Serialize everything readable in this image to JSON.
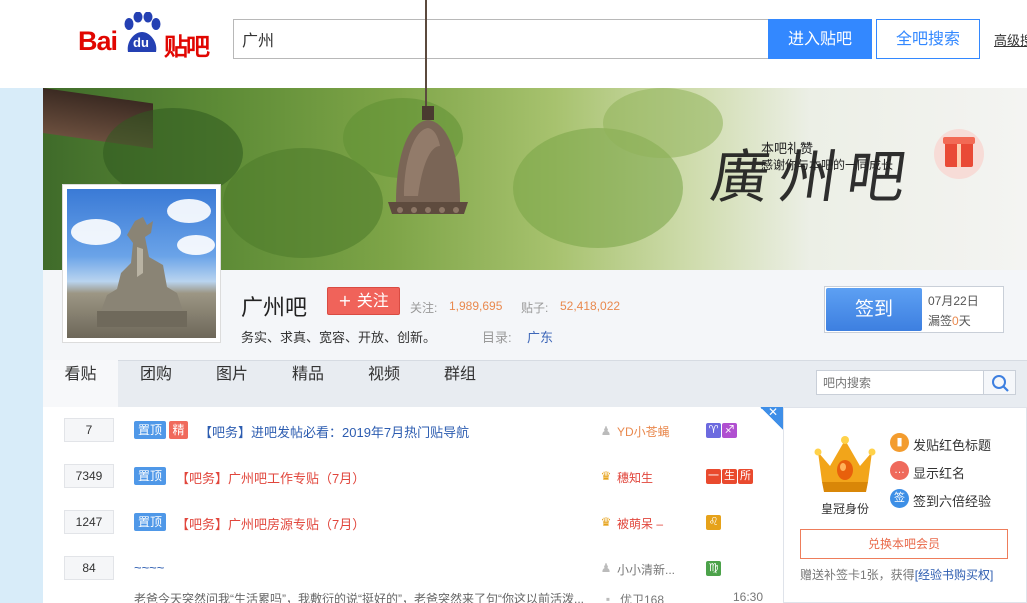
{
  "header": {
    "logo": {
      "bai": "Bai",
      "du": "du",
      "tieba": "贴吧"
    },
    "search_value": "广州",
    "enter_button": "进入贴吧",
    "all_search_button": "全吧搜索",
    "advanced_link": "高级搜"
  },
  "banner": {
    "gift_label": "本吧礼赞",
    "gift_subtitle": "感谢你与本吧的一同成长",
    "calligraphy": "廣州吧"
  },
  "forum": {
    "name": "广州吧",
    "follow_button": "+ 关注",
    "follow_label": "关注:",
    "follow_count": "1,989,695",
    "post_label": "贴子:",
    "post_count": "52,418,022",
    "slogan": "务实、求真、宽容、开放、创新。",
    "directory_label": "目录:",
    "directory_value": "广东"
  },
  "sign_in": {
    "button": "签到",
    "date": "07月22日",
    "missed_prefix": "漏签",
    "missed_days": "0",
    "missed_suffix": "天"
  },
  "nav": {
    "tabs": [
      "看贴",
      "团购",
      "图片",
      "精品",
      "视频",
      "群组"
    ],
    "search_placeholder": "吧内搜索"
  },
  "threads": [
    {
      "replies": "7",
      "top": "置顶",
      "jing": "精",
      "title": "【吧务】进吧发帖必看：2019年7月热门贴导航",
      "author": "YD小苍蝇",
      "author_badges": [
        "♈",
        "♐"
      ]
    },
    {
      "replies": "7349",
      "top": "置顶",
      "title": "【吧务】广州吧工作专贴（7月）",
      "author": "穗知生",
      "author_badges": [
        "一",
        "生",
        "所"
      ]
    },
    {
      "replies": "1247",
      "top": "置顶",
      "title": "【吧务】广州吧房源专贴（7月）",
      "author": "被萌呆 –",
      "author_badges": [
        "♌"
      ]
    },
    {
      "replies": "84",
      "title": "~~~~",
      "author": "小小清新...",
      "author_badges": [
        "♍"
      ],
      "excerpt": "老爸今天突然问我“生活累吗”，我敷衍的说“挺好的”，老爸突然来了句“你这以前活泼...",
      "last_author": "优卫168",
      "time": "16:30"
    }
  ],
  "vip_card": {
    "crown_label": "皇冠身份",
    "perks": [
      "发贴红色标题",
      "显示红名",
      "签到六倍经验"
    ],
    "perk_icons": [
      "bookmark-icon",
      "chat-icon",
      "sign-icon"
    ],
    "perk_icon_glyphs": [
      "▮",
      "…",
      "签"
    ],
    "exchange_button": "兑换本吧会员",
    "footer_text": "赠送补签卡1张，获得",
    "footer_link": "[经验书购买权]"
  },
  "colors": {
    "accent_blue": "#3388ff",
    "logo_red": "#e10601",
    "follow_red": "#f0635a",
    "count_orange": "#e9894e"
  }
}
